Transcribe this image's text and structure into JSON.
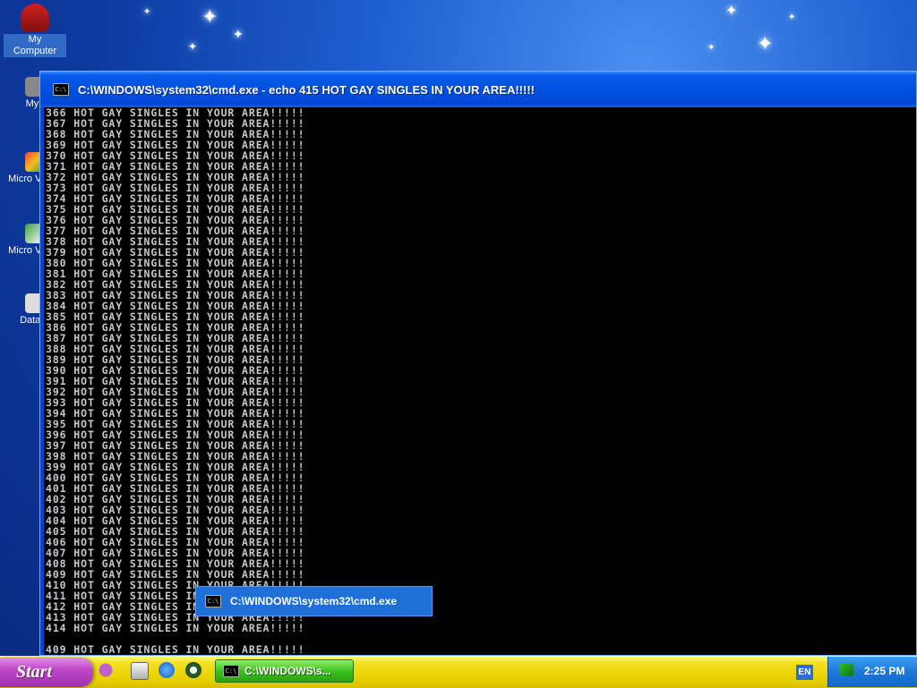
{
  "desktop": {
    "icons": [
      {
        "label": "My Computer",
        "name": "my-computer"
      },
      {
        "label": "Myp",
        "name": "my-pictures"
      },
      {
        "label": "Micro Visual",
        "name": "ms-visual-1"
      },
      {
        "label": "Micro Visual",
        "name": "ms-visual-2"
      },
      {
        "label": "DataW",
        "name": "data-w"
      }
    ]
  },
  "cmd": {
    "title": "C:\\WINDOWS\\system32\\cmd.exe - echo 415 HOT GAY SINGLES IN YOUR AREA!!!!!",
    "line_text": "HOT GAY SINGLES IN YOUR AREA!!!!!",
    "line_numbers": [
      366,
      367,
      368,
      369,
      370,
      371,
      372,
      373,
      374,
      375,
      376,
      377,
      378,
      379,
      380,
      381,
      382,
      383,
      384,
      385,
      386,
      387,
      388,
      389,
      390,
      391,
      392,
      393,
      394,
      395,
      396,
      397,
      398,
      399,
      400,
      401,
      402,
      403,
      404,
      405,
      406,
      407,
      408,
      409,
      410,
      411,
      412,
      413,
      414
    ],
    "trailing_blank": "",
    "last_line": "409 HOT GAY SINGLES IN YOUR AREA!!!!!"
  },
  "task_popup": {
    "label": "C:\\WINDOWS\\system32\\cmd.exe",
    "icon": "cmd-icon"
  },
  "taskbar": {
    "start_label": "Start",
    "task_button_label": "C:\\WINDOWS\\s...",
    "language": "EN",
    "clock": "2:25 PM"
  },
  "colors": {
    "taskbar": "#e8d000",
    "start_button": "#c048c8",
    "window_title": "#0050e0",
    "console_bg": "#000000",
    "console_text": "#c8c8c8"
  }
}
